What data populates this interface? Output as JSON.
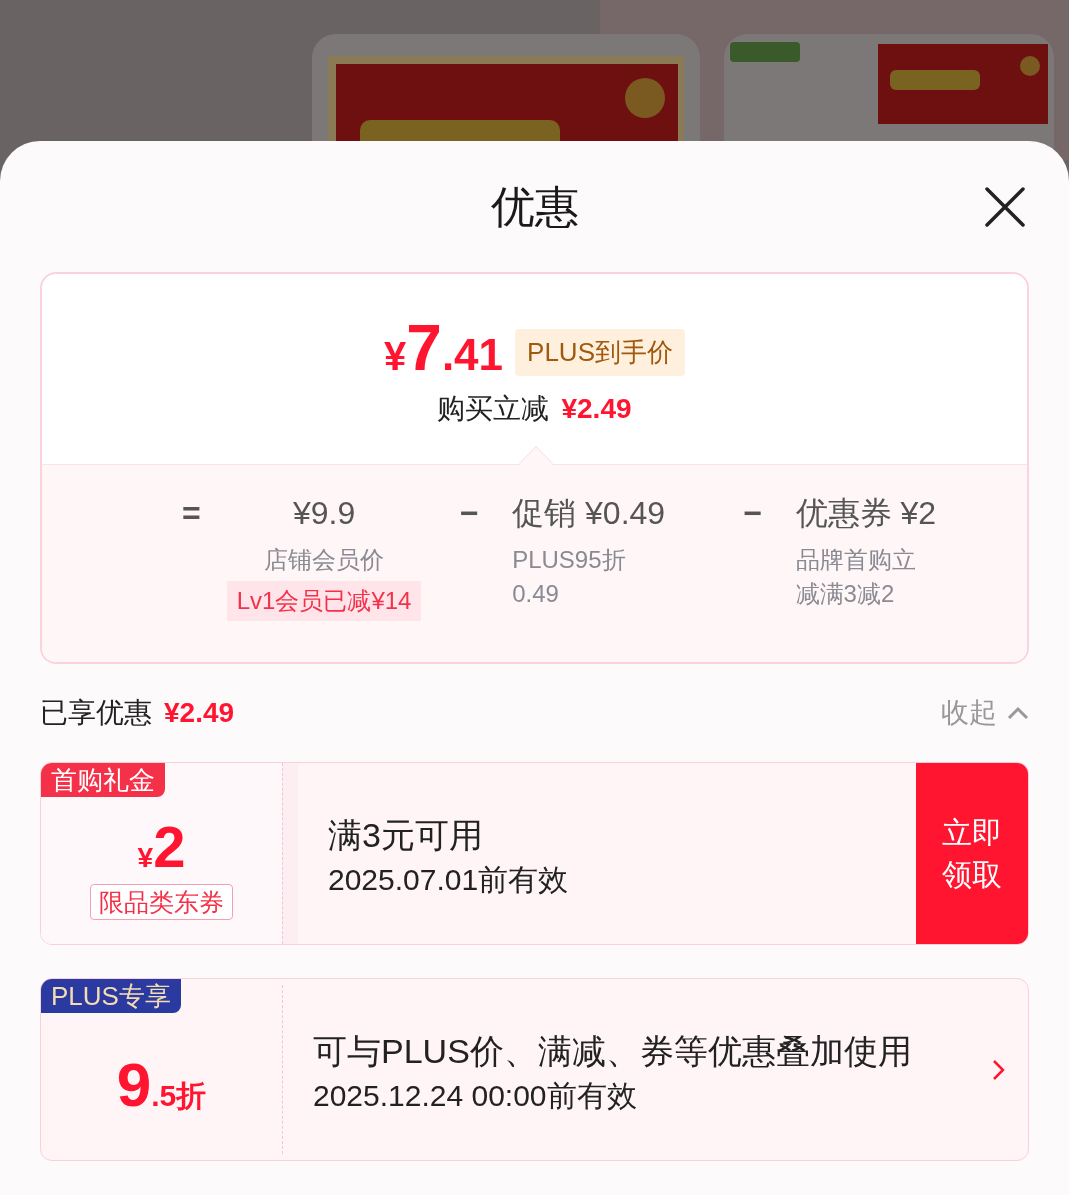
{
  "sheet": {
    "title": "优惠"
  },
  "price_summary": {
    "currency": "¥",
    "integer": "7",
    "decimal": ".41",
    "tag": "PLUS到手价",
    "saving_label": "购买立减",
    "saving_amount": "¥2.49"
  },
  "breakdown": [
    {
      "operator": "=",
      "value": "¥9.9",
      "note_lines": [
        "店铺会员价"
      ],
      "badge": "Lv1会员已减¥14"
    },
    {
      "operator": "−",
      "value": "促销 ¥0.49",
      "note_lines": [
        "PLUS95折",
        "0.49"
      ]
    },
    {
      "operator": "−",
      "value": "优惠券 ¥2",
      "note_lines": [
        "品牌首购立",
        "减满3减2"
      ]
    }
  ],
  "enjoyed": {
    "label": "已享优惠",
    "amount": "¥2.49",
    "toggle": "收起",
    "expanded": true
  },
  "coupons": [
    {
      "kind": "claim",
      "tag": "首购礼金",
      "color": "#f5314a",
      "currency": "¥",
      "amount": "2",
      "scope": "限品类东券",
      "condition": "满3元可用",
      "validity": "2025.07.01前有效",
      "action": "立即领取"
    },
    {
      "kind": "link",
      "tag": "PLUS专享",
      "color": "#2b3aa0",
      "amount": "9",
      "amount_small": ".5折",
      "condition": "可与PLUS价、满减、券等优惠叠加使用",
      "validity": "2025.12.24 00:00前有效"
    }
  ]
}
